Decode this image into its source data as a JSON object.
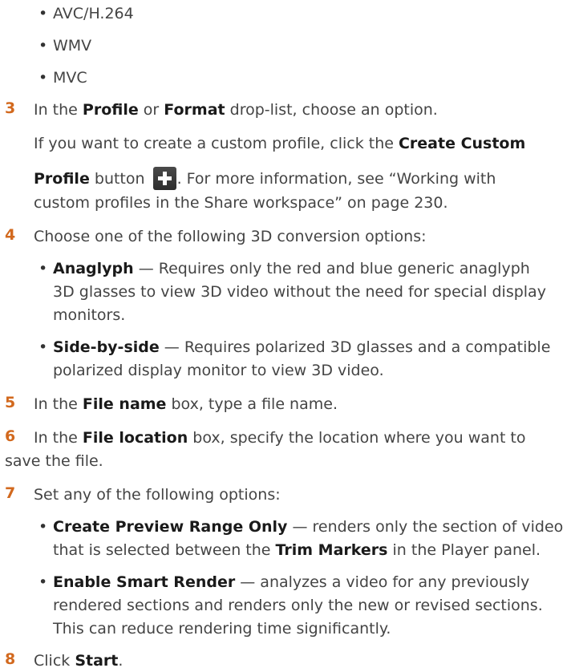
{
  "formats": [
    "AVC/H.264",
    "WMV",
    "MVC"
  ],
  "step3": {
    "number": "3",
    "a": "In the ",
    "profile": "Profile",
    "or": " or ",
    "format": "Format",
    "b": " drop-list, choose an option.",
    "c1": "If you want to create a custom profile, click the ",
    "create_custom": "Create Custom",
    "profile_btn": "Profile",
    "c2": " button ",
    "c3": ". For more information, see “Working with",
    "c4": "custom profiles in the Share workspace” on page 230."
  },
  "step4": {
    "number": "4",
    "text": "Choose one of the following 3D conversion options:",
    "anaglyph": "Anaglyph",
    "anaglyph_desc1": " — Requires only the red and blue generic anaglyph",
    "anaglyph_desc2": "3D glasses to view 3D video without the need for special display",
    "anaglyph_desc3": "monitors.",
    "sbs": "Side-by-side",
    "sbs_desc1": " — Requires polarized 3D glasses and a compatible",
    "sbs_desc2": "polarized display monitor to view 3D video."
  },
  "step5": {
    "number": "5",
    "a": "In the ",
    "file_name": "File name",
    "b": " box, type a file name."
  },
  "step6": {
    "number": "6",
    "a": "In the ",
    "file_location": "File location",
    "b": " box, specify the location where you want to",
    "c": "save the file."
  },
  "step7": {
    "number": "7",
    "text": "Set any of the following options:",
    "cpro": "Create Preview Range Only",
    "cpro_desc1": " — renders only the section of video",
    "cpro_desc2a": "that is selected between the ",
    "trim": "Trim Markers",
    "cpro_desc2b": " in the Player panel.",
    "esr": "Enable Smart Render",
    "esr_desc1": " — analyzes a video for any previously",
    "esr_desc2": "rendered sections and renders only the new or revised sections.",
    "esr_desc3": "This can reduce rendering time significantly."
  },
  "step8": {
    "number": "8",
    "a": "Click ",
    "start": "Start",
    "b": "."
  }
}
